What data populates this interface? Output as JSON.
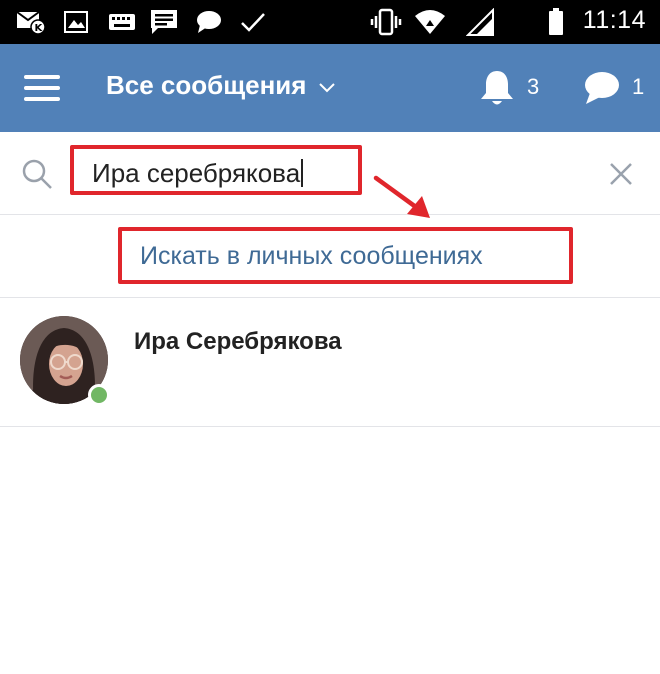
{
  "status_bar": {
    "time": "11:14",
    "icons": [
      "sms-k-icon",
      "image-icon",
      "keyboard-icon",
      "message-icon",
      "chat-bubble-icon",
      "check-icon",
      "vibrate-icon",
      "wifi-icon",
      "signal-icon",
      "battery-icon"
    ]
  },
  "header": {
    "title": "Все сообщения",
    "notifications_count": "3",
    "messages_count": "1",
    "background_color": "#5181b8"
  },
  "search": {
    "query": "Ира серебрякова",
    "search_in_messages_label": "Искать в личных сообщениях",
    "highlight_color": "#e0262c"
  },
  "results": [
    {
      "name": "Ира Серебрякова",
      "online": true
    }
  ]
}
